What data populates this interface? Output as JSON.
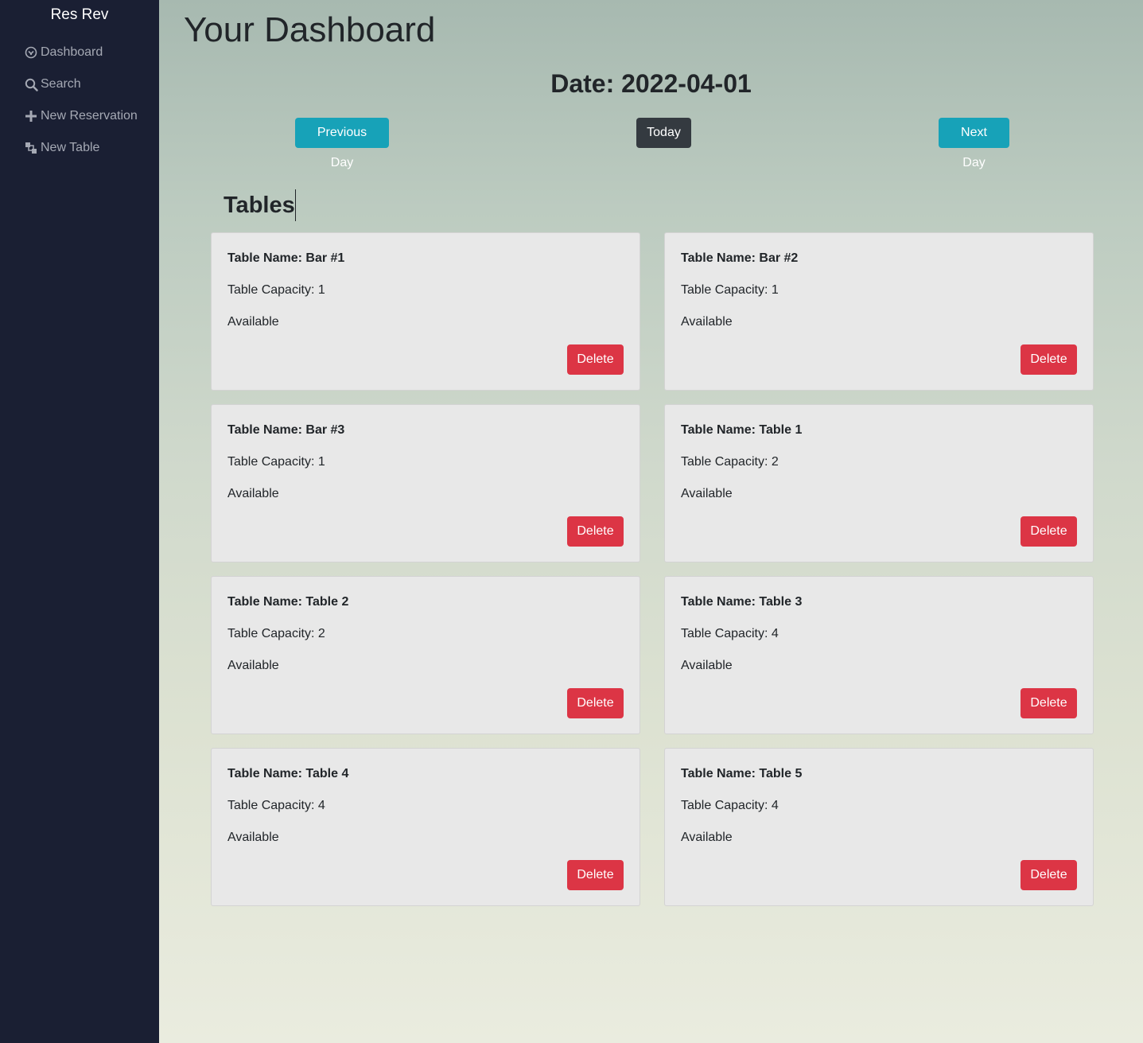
{
  "sidebar": {
    "brand": "Res Rev",
    "items": [
      {
        "label": "Dashboard",
        "icon": "dashboard-icon"
      },
      {
        "label": "Search",
        "icon": "search-icon"
      },
      {
        "label": "New Reservation",
        "icon": "plus-icon"
      },
      {
        "label": "New Table",
        "icon": "layers-icon"
      }
    ]
  },
  "main": {
    "title": "Your Dashboard",
    "date_label": "Date: 2022-04-01",
    "buttons": {
      "previous": "Previous Day",
      "today": "Today",
      "next": "Next Day"
    },
    "tables_heading": "Tables",
    "tables": [
      {
        "name": "Table Name: Bar #1",
        "capacity": "Table Capacity: 1",
        "status": "Available",
        "action": "Delete"
      },
      {
        "name": "Table Name: Bar #2",
        "capacity": "Table Capacity: 1",
        "status": "Available",
        "action": "Delete"
      },
      {
        "name": "Table Name: Bar #3",
        "capacity": "Table Capacity: 1",
        "status": "Available",
        "action": "Delete"
      },
      {
        "name": "Table Name: Table 1",
        "capacity": "Table Capacity: 2",
        "status": "Available",
        "action": "Delete"
      },
      {
        "name": "Table Name: Table 2",
        "capacity": "Table Capacity: 2",
        "status": "Available",
        "action": "Delete"
      },
      {
        "name": "Table Name: Table 3",
        "capacity": "Table Capacity: 4",
        "status": "Available",
        "action": "Delete"
      },
      {
        "name": "Table Name: Table 4",
        "capacity": "Table Capacity: 4",
        "status": "Available",
        "action": "Delete"
      },
      {
        "name": "Table Name: Table 5",
        "capacity": "Table Capacity: 4",
        "status": "Available",
        "action": "Delete"
      }
    ]
  },
  "colors": {
    "sidebar_bg": "#1a1f33",
    "info": "#17a2b8",
    "dark": "#343a40",
    "danger": "#dc3545",
    "card_bg": "#e8e8e8"
  }
}
